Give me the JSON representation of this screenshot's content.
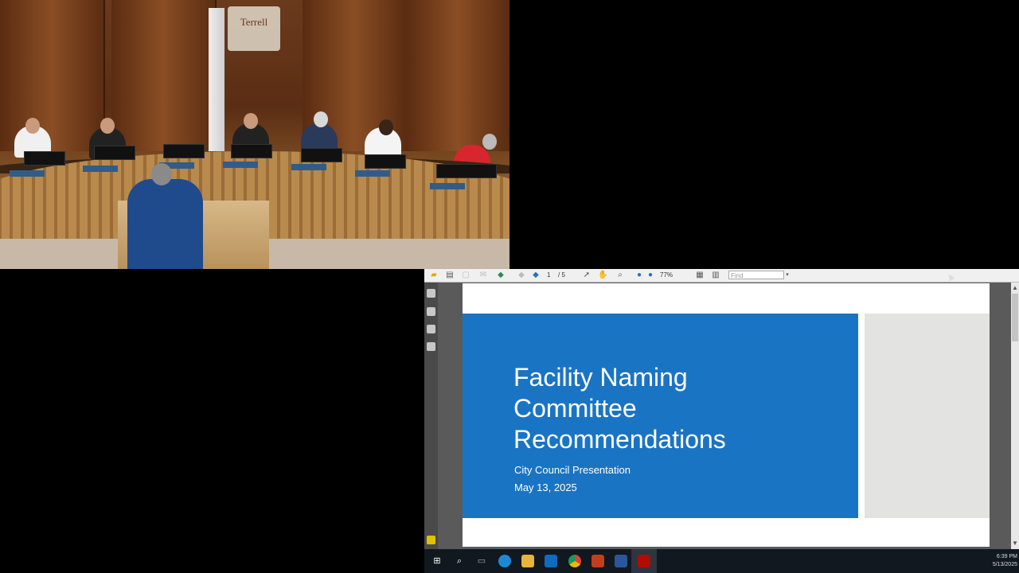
{
  "video": {
    "seal_text": "Terrell"
  },
  "reader": {
    "toolbar": {
      "page_current": "1",
      "page_total": "/ 5",
      "zoom": "77%",
      "find_placeholder": "Find"
    },
    "slide": {
      "title_line1": "Facility Naming",
      "title_line2": "Committee",
      "title_line3": "Recommendations",
      "subtitle": "City Council Presentation",
      "date": "May 13, 2025"
    },
    "colors": {
      "slide_blue": "#1a74c4",
      "slide_side": "#e3e3e1"
    }
  },
  "taskbar": {
    "icons": [
      "windows-start-icon",
      "search-icon",
      "task-view-icon",
      "edge-icon",
      "file-explorer-icon",
      "outlook-icon",
      "chrome-icon",
      "powerpoint-icon",
      "word-icon",
      "pdf-reader-icon"
    ],
    "time": "6:39 PM",
    "date": "5/13/2025"
  }
}
